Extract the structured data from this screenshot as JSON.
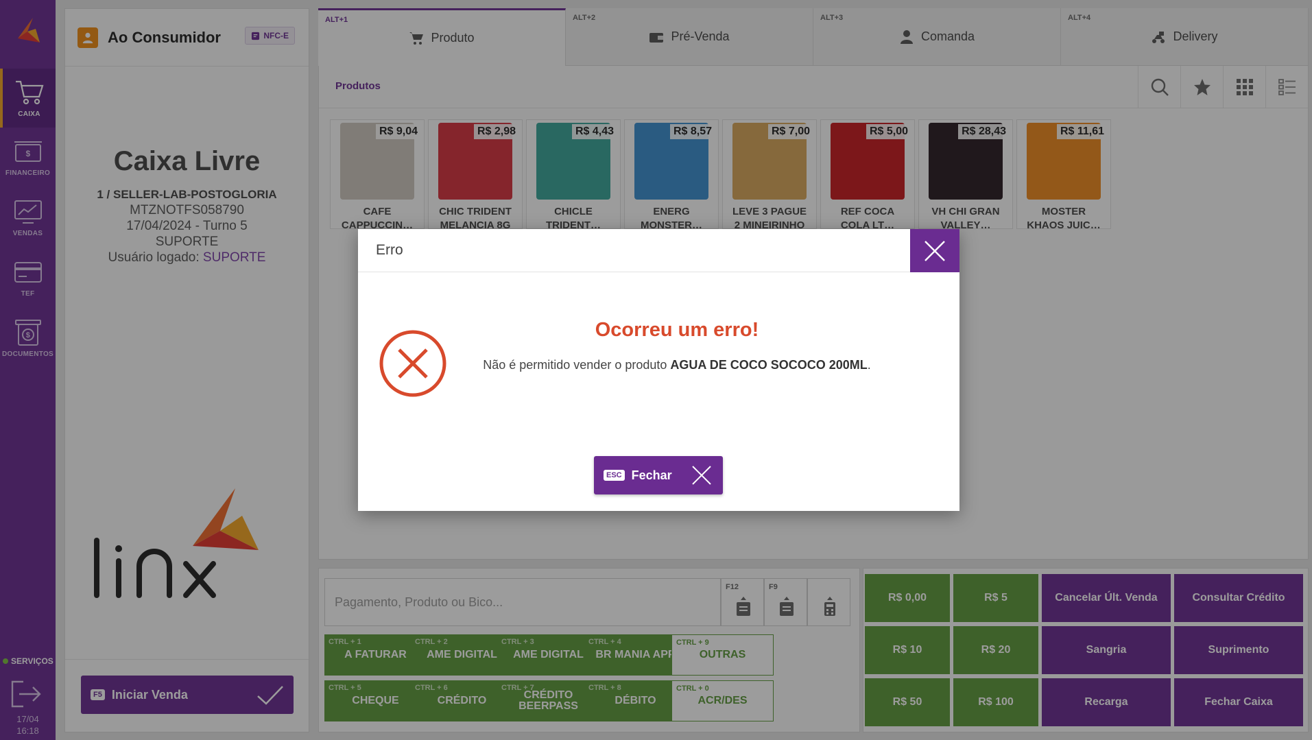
{
  "nav": {
    "items": [
      {
        "label": "CAIXA",
        "icon": "cart-icon"
      },
      {
        "label": "FINANCEIRO",
        "icon": "money-icon"
      },
      {
        "label": "VENDAS",
        "icon": "sales-chart-icon"
      },
      {
        "label": "TEF",
        "icon": "card-icon"
      },
      {
        "label": "DOCUMENTOS",
        "icon": "documents-icon"
      }
    ],
    "services_label": "SERVIÇOS",
    "date": "17/04",
    "time": "16:18"
  },
  "customer": {
    "name": "Ao Consumidor",
    "doc_type": "NFC-E"
  },
  "caixa": {
    "status": "Caixa Livre",
    "store": "1 / SELLER-LAB-POSTOGLORIA",
    "terminal": "MTZNOTFS058790",
    "shift": "17/04/2024 - Turno 5",
    "operator": "SUPORTE",
    "user_prefix": "Usuário logado:",
    "user": "SUPORTE"
  },
  "iniciar": {
    "key": "F5",
    "label": "Iniciar Venda"
  },
  "tabs": [
    {
      "shortcut": "ALT+1",
      "label": "Produto",
      "icon": "cart-icon",
      "active": true
    },
    {
      "shortcut": "ALT+2",
      "label": "Pré-Venda",
      "icon": "wallet-icon",
      "active": false
    },
    {
      "shortcut": "ALT+3",
      "label": "Comanda",
      "icon": "person-icon",
      "active": false
    },
    {
      "shortcut": "ALT+4",
      "label": "Delivery",
      "icon": "delivery-icon",
      "active": false
    }
  ],
  "products": {
    "title": "Produtos",
    "items": [
      {
        "price": "R$ 9,04",
        "name1": "CAFE",
        "name2": "CAPPUCCIN…",
        "color": "#cfc8c0"
      },
      {
        "price": "R$ 2,98",
        "name1": "CHIC TRIDENT",
        "name2": "MELANCIA 8G",
        "color": "#d8333f"
      },
      {
        "price": "R$ 4,43",
        "name1": "CHICLE",
        "name2": "TRIDENT…",
        "color": "#3aa59a"
      },
      {
        "price": "R$ 8,57",
        "name1": "ENERG",
        "name2": "MONSTER…",
        "color": "#3b8fd1"
      },
      {
        "price": "R$ 7,00",
        "name1": "LEVE 3 PAGUE",
        "name2": "2 MINEIRINHO",
        "color": "#d9a75a"
      },
      {
        "price": "R$ 5,00",
        "name1": "REF COCA",
        "name2": "COLA LT…",
        "color": "#c91a1f"
      },
      {
        "price": "R$ 28,43",
        "name1": "VH CHI GRAN",
        "name2": "VALLEY…",
        "color": "#2a1c24"
      },
      {
        "price": "R$ 11,61",
        "name1": "MOSTER",
        "name2": "KHAOS JUIC…",
        "color": "#f08a1e"
      }
    ]
  },
  "payment": {
    "placeholder": "Pagamento, Produto ou Bico...",
    "tools": [
      {
        "key": "F12",
        "icon": "receipt-icon"
      },
      {
        "key": "F9",
        "icon": "receipt-icon"
      },
      {
        "key": "",
        "icon": "calculator-icon"
      }
    ],
    "buttons": [
      {
        "key": "CTRL + 1",
        "label": "A FATURAR"
      },
      {
        "key": "CTRL + 2",
        "label": "AME DIGITAL"
      },
      {
        "key": "CTRL + 3",
        "label": "AME DIGITAL"
      },
      {
        "key": "CTRL + 4",
        "label": "BR MANIA APP"
      },
      {
        "key": "CTRL + 9",
        "label": "OUTRAS"
      },
      {
        "key": "CTRL + 5",
        "label": "CHEQUE"
      },
      {
        "key": "CTRL + 6",
        "label": "CRÉDITO"
      },
      {
        "key": "CTRL + 7",
        "label": "CRÉDITO BEERPASS"
      },
      {
        "key": "CTRL + 8",
        "label": "DÉBITO"
      },
      {
        "key": "CTRL + 0",
        "label": "ACR/DES"
      }
    ]
  },
  "quick": {
    "cash": [
      "R$ 0,00",
      "R$ 5",
      "R$ 10",
      "R$ 20",
      "R$ 50",
      "R$ 100"
    ],
    "actions": [
      "Cancelar Últ. Venda",
      "Consultar Crédito",
      "Sangria",
      "Suprimento",
      "Recarga",
      "Fechar Caixa"
    ]
  },
  "dialog": {
    "title": "Erro",
    "heading": "Ocorreu um erro!",
    "message_prefix": "Não é permitido vender o produto ",
    "product": "AGUA DE COCO SOCOCO 200ML",
    "message_suffix": ".",
    "close_key": "ESC",
    "close_label": "Fechar"
  },
  "colors": {
    "brand": "#6a2c91",
    "green": "#5e9a3c",
    "error": "#d84a2c",
    "accent": "#f08c14"
  }
}
